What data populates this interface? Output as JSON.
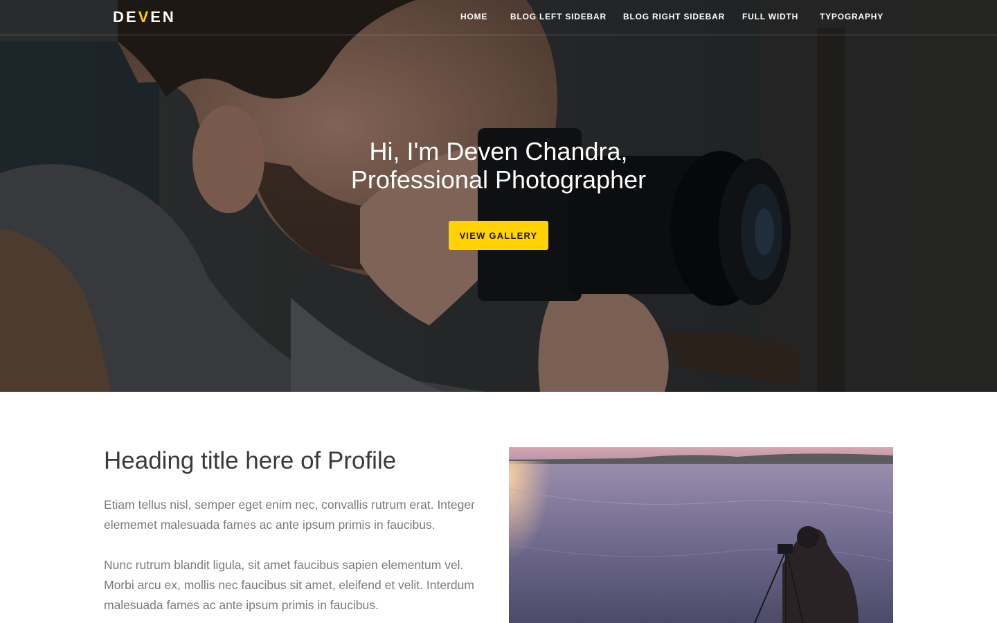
{
  "brand": {
    "logo_prefix": "DE",
    "logo_accent": "V",
    "logo_suffix": "EN",
    "accent_color": "#ffd200"
  },
  "nav": {
    "items": [
      {
        "label": "HOME"
      },
      {
        "label": "BLOG LEFT SIDEBAR"
      },
      {
        "label": "BLOG RIGHT SIDEBAR"
      },
      {
        "label": "FULL WIDTH"
      },
      {
        "label": "TYPOGRAPHY"
      }
    ]
  },
  "hero": {
    "title_line1": "Hi, I'm Deven Chandra,",
    "title_line2": "Professional Photographer",
    "cta_label": "VIEW GALLERY",
    "background_image": "photographer-with-camera-photo"
  },
  "profile": {
    "heading": "Heading title here of Profile",
    "paragraph1": "Etiam tellus nisl, semper eget enim nec, convallis rutrum erat. Integer elememet malesuada fames ac ante ipsum primis in faucibus.",
    "paragraph2": "Nunc rutrum blandit ligula, sit amet faucibus sapien elementum vel. Morbi arcu ex, mollis nec faucibus sit amet, eleifend et velit. Interdum malesuada fames ac ante ipsum primis in faucibus.",
    "image": "photographer-on-frozen-lake-photo"
  }
}
